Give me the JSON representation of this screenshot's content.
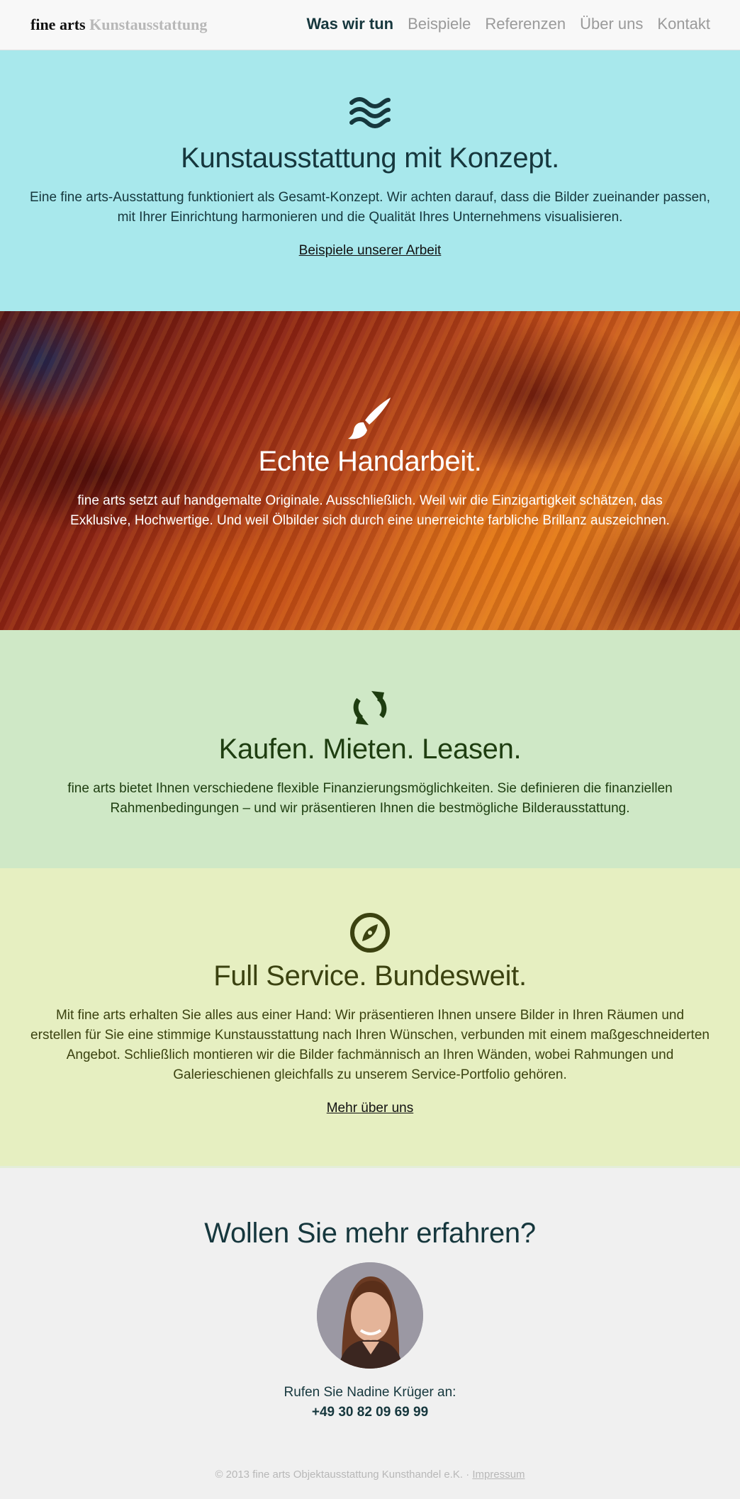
{
  "header": {
    "brand_primary": "fine arts",
    "brand_secondary": "Kunstausstattung",
    "nav": [
      {
        "label": "Was wir tun",
        "active": true
      },
      {
        "label": "Beispiele",
        "active": false
      },
      {
        "label": "Referenzen",
        "active": false
      },
      {
        "label": "Über uns",
        "active": false
      },
      {
        "label": "Kontakt",
        "active": false
      }
    ]
  },
  "concept": {
    "icon": "waves-icon",
    "title": "Kunstausstattung mit Konzept.",
    "text": "Eine fine arts-Ausstattung funktioniert als Gesamt-Konzept. Wir achten darauf, dass die Bilder zueinander passen, mit Ihrer Einrichtung harmonieren und die Qualität Ihres Unternehmens visualisieren.",
    "link": "Beispiele unserer Arbeit",
    "color": "#a8e8ec"
  },
  "handwork": {
    "icon": "paintbrush-icon",
    "title": "Echte Handarbeit.",
    "text": "fine arts setzt auf handgemalte Originale. Ausschließlich. Weil wir die Einzigartigkeit schätzen, das Exklusive, Hochwertige. Und weil Ölbilder sich durch eine unerreichte farbliche Brillanz auszeichnen."
  },
  "finance": {
    "icon": "refresh-icon",
    "title": "Kaufen. Mieten. Leasen.",
    "text": "fine arts bietet Ihnen verschiedene flexible Finanzierungsmöglichkeiten. Sie definieren die finanziellen Rahmenbedingungen – und wir präsentieren Ihnen die bestmögliche Bilderausstattung.",
    "color": "#cfe8c6"
  },
  "service": {
    "icon": "compass-icon",
    "title": "Full Service. Bundesweit.",
    "text": "Mit fine arts erhalten Sie alles aus einer Hand: Wir präsentieren Ihnen unsere Bilder in Ihren Räumen und erstellen für Sie eine stimmige Kunstausstattung nach Ihren Wünschen, verbunden mit einem maßgeschneiderten Angebot. Schließlich montieren wir die Bilder fachmännisch an Ihren Wänden, wobei Rahmungen und Galerieschienen gleichfalls zu unserem Service-Portfolio gehören.",
    "link": "Mehr über uns",
    "color": "#e6efc1"
  },
  "contact": {
    "title": "Wollen Sie mehr erfahren?",
    "call_text": "Rufen Sie Nadine Krüger an:",
    "phone": "+49 30 82 09 69 99"
  },
  "footer": {
    "copyright": "© 2013 fine arts Objektausstattung Kunsthandel e.K. · ",
    "impressum": "Impressum"
  }
}
